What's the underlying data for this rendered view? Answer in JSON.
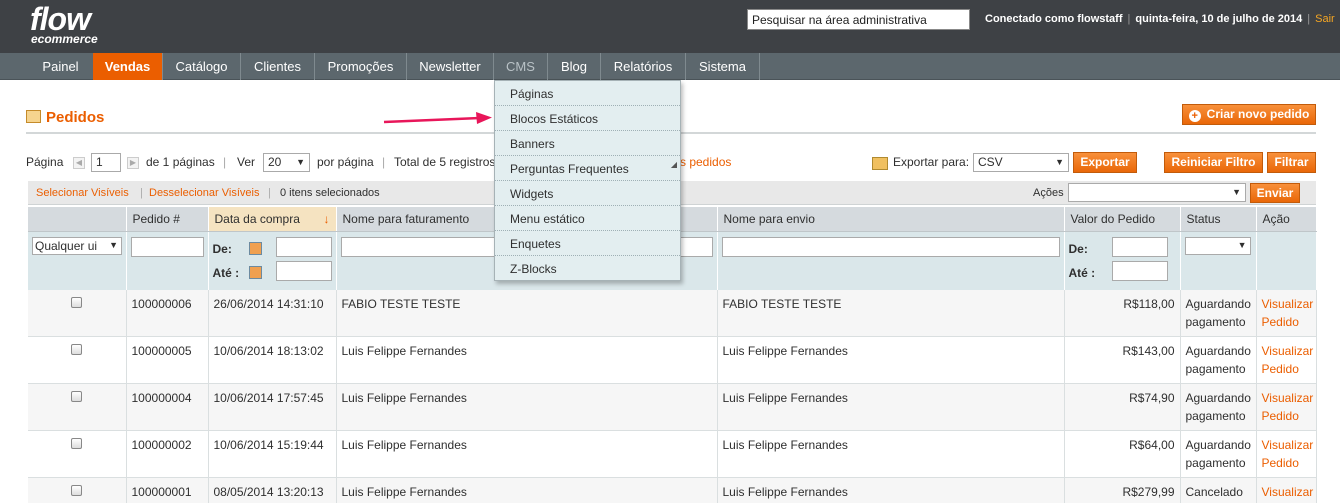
{
  "brand": {
    "line1": "flow",
    "line2": "ecommerce"
  },
  "header": {
    "search_value": "Pesquisar na área administrativa",
    "user": "Conectado como flowstaff",
    "date": "quinta-feira, 10 de julho de 2014",
    "logout": "Sair"
  },
  "nav": {
    "items": [
      {
        "label": "Painel"
      },
      {
        "label": "Vendas"
      },
      {
        "label": "Catálogo"
      },
      {
        "label": "Clientes"
      },
      {
        "label": "Promoções"
      },
      {
        "label": "Newsletter"
      },
      {
        "label": "CMS"
      },
      {
        "label": "Blog"
      },
      {
        "label": "Relatórios"
      },
      {
        "label": "Sistema"
      }
    ],
    "active": "Vendas",
    "accent": "#eb5e00"
  },
  "cms_menu": {
    "items": [
      "Páginas",
      "Blocos Estáticos",
      "Banners",
      "Perguntas Frequentes",
      "Widgets",
      "Menu estático",
      "Enquetes",
      "Z-Blocks"
    ]
  },
  "page": {
    "title": "Pedidos",
    "new_button": "Criar novo pedido"
  },
  "pager": {
    "page_label": "Página",
    "page_value": "1",
    "of_pages": "de 1 páginas",
    "view_label": "Ver",
    "per_page": "20",
    "per_page_label": "por página",
    "total": "Total de 5 registros",
    "rss_tail": "s pedidos"
  },
  "export": {
    "label": "Exportar para:",
    "format": "CSV",
    "button": "Exportar"
  },
  "filters": {
    "reset": "Reiniciar Filtro",
    "apply": "Filtrar"
  },
  "massaction": {
    "select_visible": "Selecionar Visíveis",
    "deselect_visible": "Desselecionar Visíveis",
    "selected": "0 itens selecionados",
    "actions_label": "Ações",
    "submit": "Enviar"
  },
  "grid": {
    "columns": [
      "Pedido #",
      "Data da compra",
      "Nome para faturamento",
      "Nome para envio",
      "Valor do Pedido",
      "Status",
      "Ação"
    ],
    "filter": {
      "any": "Qualquer ui",
      "from": "De:",
      "to": "Até :"
    },
    "rows": [
      {
        "id": "100000006",
        "date": "26/06/2014 14:31:10",
        "bill": "FABIO TESTE TESTE",
        "ship": "FABIO TESTE TESTE",
        "value": "R$118,00",
        "status": "Aguardando pagamento",
        "action": "Visualizar Pedido"
      },
      {
        "id": "100000005",
        "date": "10/06/2014 18:13:02",
        "bill": "Luis Felippe Fernandes",
        "ship": "Luis Felippe Fernandes",
        "value": "R$143,00",
        "status": "Aguardando pagamento",
        "action": "Visualizar Pedido"
      },
      {
        "id": "100000004",
        "date": "10/06/2014 17:57:45",
        "bill": "Luis Felippe Fernandes",
        "ship": "Luis Felippe Fernandes",
        "value": "R$74,90",
        "status": "Aguardando pagamento",
        "action": "Visualizar Pedido"
      },
      {
        "id": "100000002",
        "date": "10/06/2014 15:19:44",
        "bill": "Luis Felippe Fernandes",
        "ship": "Luis Felippe Fernandes",
        "value": "R$64,00",
        "status": "Aguardando pagamento",
        "action": "Visualizar Pedido"
      },
      {
        "id": "100000001",
        "date": "08/05/2014 13:20:13",
        "bill": "Luis Felippe Fernandes",
        "ship": "Luis Felippe Fernandes",
        "value": "R$279,99",
        "status": "Cancelado",
        "action": "Visualizar Pedido"
      }
    ]
  }
}
